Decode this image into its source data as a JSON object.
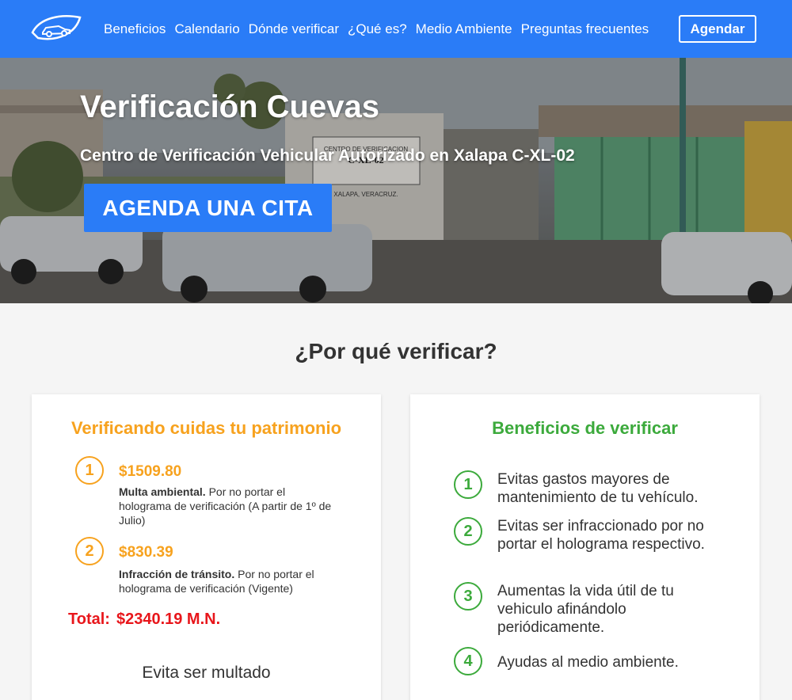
{
  "nav": {
    "links": [
      "Beneficios",
      "Calendario",
      "Dónde verificar",
      "¿Qué es?",
      "Medio Ambiente",
      "Preguntas frecuentes"
    ],
    "cta": "Agendar",
    "colors": {
      "primary": "#2a7cf7"
    }
  },
  "hero": {
    "title": "Verificación Cuevas",
    "subtitle": "Centro de Verificación Vehicular Autorizado en Xalapa C-XL-02",
    "cta": "AGENDA UNA CITA",
    "sign_lines": [
      "CENTRO DE VERIFICACION",
      "C-XL-02",
      "XALAPA, VERACRUZ."
    ]
  },
  "section": {
    "title": "¿Por qué verificar?"
  },
  "left_card": {
    "heading": "Verificando cuidas tu patrimonio",
    "fines": [
      {
        "num": "1",
        "amount": "$1509.80",
        "label": "Multa ambiental.",
        "desc": " Por no portar el holograma de verificación (A partir de 1º de Julio)"
      },
      {
        "num": "2",
        "amount": "$830.39",
        "label": "Infracción de tránsito.",
        "desc": " Por no portar el holograma de verificación (Vigente)"
      }
    ],
    "total_label": "Total:",
    "total_value": "$2340.19 M.N.",
    "avoid": "Evita ser multado",
    "colors": {
      "accent": "#f7a21e",
      "total": "#e8161b"
    }
  },
  "right_card": {
    "heading": "Beneficios de verificar",
    "items": [
      {
        "num": "1",
        "text": "Evitas gastos mayores de mantenimiento de tu vehículo."
      },
      {
        "num": "2",
        "text": "Evitas ser infraccionado por no portar el holograma respectivo."
      },
      {
        "num": "3",
        "text": "Aumentas la vida útil de tu vehiculo afinándolo periódicamente."
      },
      {
        "num": "4",
        "text": "Ayudas al medio ambiente."
      }
    ],
    "colors": {
      "accent": "#3caa3c"
    }
  }
}
